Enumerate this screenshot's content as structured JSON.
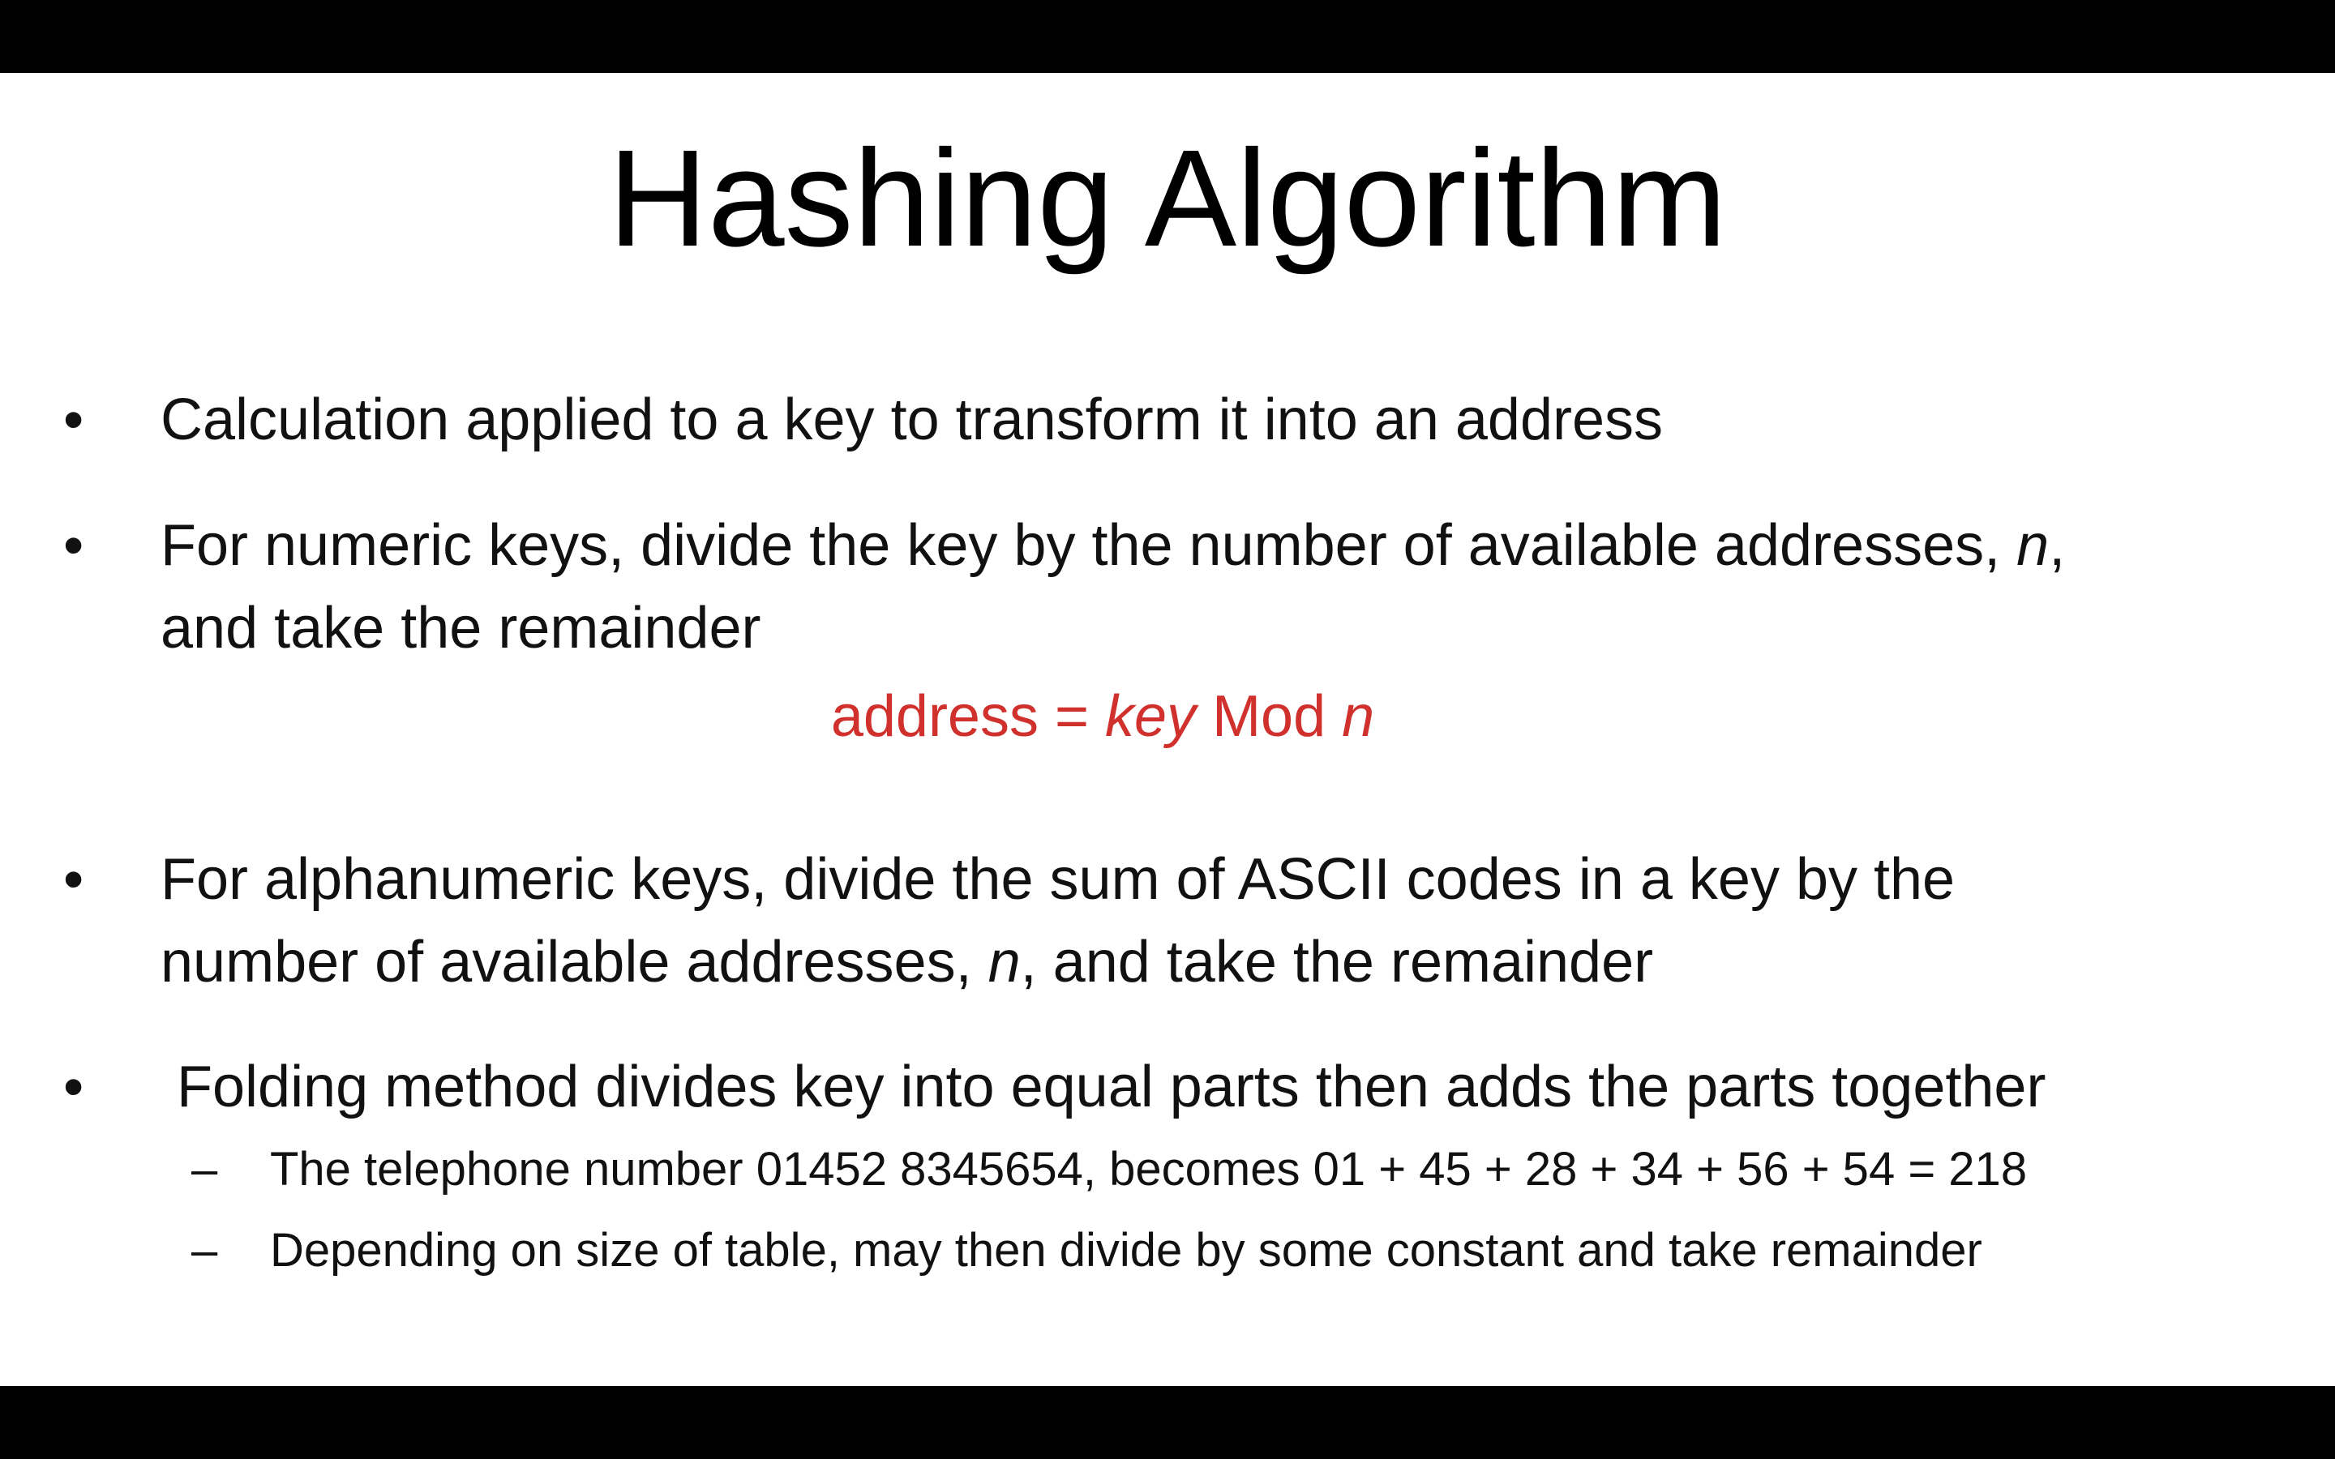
{
  "slide": {
    "title": "Hashing Algorithm",
    "bullet_char": "•",
    "dash_char": "–",
    "bullets": [
      {
        "lines": [
          "Calculation applied to a key to transform it into an address"
        ]
      },
      {
        "line1_pre": "For numeric keys, divide the key by the number of available addresses, ",
        "line1_var": "n",
        "line1_post": ",",
        "line2": "and take the remainder"
      },
      {
        "line1": "For alphanumeric keys, divide the sum of ASCII codes in a key by the",
        "line2_pre": "number of available addresses, ",
        "line2_var": "n",
        "line2_post": ", and take the remainder"
      },
      {
        "lines": [
          "Folding method divides key into equal parts then adds the parts together"
        ]
      }
    ],
    "formula": {
      "pre": "address = ",
      "key": "key",
      "mid": " Mod ",
      "var": "n"
    },
    "sub_bullets": [
      "The telephone number 01452 8345654, becomes 01 + 45 + 28 + 34 + 56 + 54  = 218",
      "Depending on size of table, may then divide by some constant and take remainder"
    ],
    "colors": {
      "formula": "#d0312d",
      "text": "#111111",
      "background": "#ffffff",
      "letterbox": "#000000"
    }
  }
}
